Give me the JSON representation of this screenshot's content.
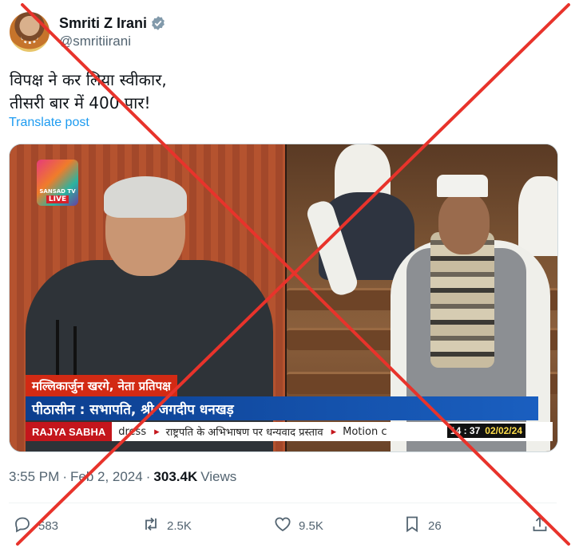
{
  "author": {
    "display_name": "Smriti Z Irani",
    "handle": "@smritiirani",
    "verified": true
  },
  "tweet": {
    "text_line1": "विपक्ष ने कर लिया स्वीकार,",
    "text_line2": "तीसरी बार में 400 पार!",
    "translate_label": "Translate post"
  },
  "video": {
    "logo_text": "SANSAD TV",
    "live_label": "LIVE",
    "lower_third_speaker": "मल्लिकार्जुन खरगे, नेता प्रतिपक्ष",
    "lower_third_presiding": "पीठासीन : सभापति, श्री जगदीप धनखड़",
    "channel_label": "RAJYA SABHA",
    "ticker_items": [
      "dress",
      "राष्ट्रपति के अभिभाषण पर धन्यवाद प्रस्ताव",
      "Motion c"
    ],
    "clock_time": "14 : 37",
    "clock_date": "02/02/24"
  },
  "meta": {
    "time": "3:55 PM",
    "separator": "·",
    "date": "Feb 2, 2024",
    "separator2": "·",
    "views_count": "303.4K",
    "views_label": "Views"
  },
  "actions": {
    "replies": "583",
    "reposts": "2.5K",
    "likes": "9.5K",
    "bookmarks": "26"
  },
  "colors": {
    "accent": "#1d9bf0",
    "cross": "#e8332b",
    "muted_text": "#536471"
  }
}
